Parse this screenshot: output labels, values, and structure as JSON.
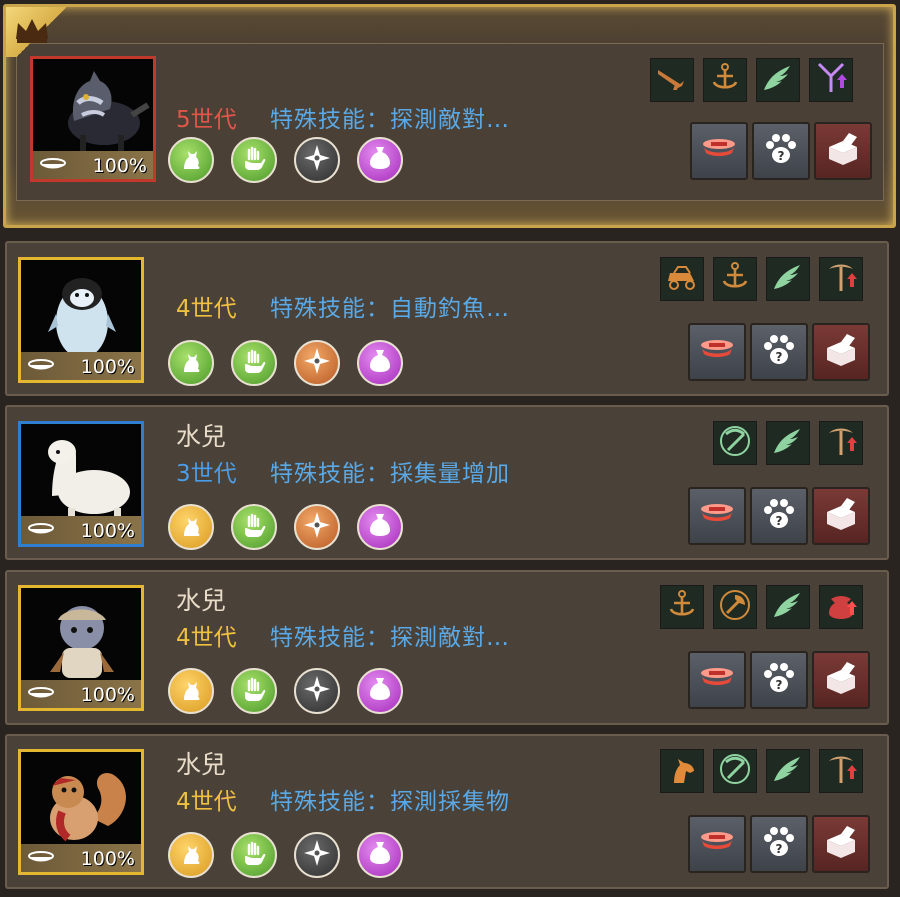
{
  "pets": [
    {
      "featured": true,
      "name": "",
      "generation": "5世代",
      "gen_color": "red",
      "skill": "特殊技能：探測敵對…",
      "percent": "100%",
      "frame": "red",
      "animal": "wolf",
      "traits": [
        {
          "icon": "cat-icon",
          "color": "green"
        },
        {
          "icon": "hand-icon",
          "color": "green"
        },
        {
          "icon": "compass-icon",
          "color": "gray"
        },
        {
          "icon": "pouch-icon",
          "color": "purple"
        }
      ],
      "badges": [
        "musket-icon",
        "anchor-icon",
        "wing-icon",
        "arrow-up-icon"
      ]
    },
    {
      "featured": false,
      "name": "",
      "generation": "4世代",
      "gen_color": "gold",
      "skill": "特殊技能：自動釣魚…",
      "percent": "100%",
      "frame": "gold",
      "animal": "penguin",
      "traits": [
        {
          "icon": "cat-icon",
          "color": "green"
        },
        {
          "icon": "hand-icon",
          "color": "green"
        },
        {
          "icon": "compass-icon",
          "color": "orange"
        },
        {
          "icon": "pouch-icon",
          "color": "purple"
        }
      ],
      "badges": [
        "carriage-icon",
        "anchor-icon",
        "wing-icon",
        "pickaxe-up-icon"
      ]
    },
    {
      "featured": false,
      "name": "水兒",
      "generation": "3世代",
      "gen_color": "blue",
      "skill": "特殊技能：採集量增加",
      "percent": "100%",
      "frame": "blue",
      "animal": "alpaca",
      "traits": [
        {
          "icon": "cat-icon",
          "color": "gold"
        },
        {
          "icon": "hand-icon",
          "color": "green"
        },
        {
          "icon": "compass-icon",
          "color": "orange"
        },
        {
          "icon": "pouch-icon",
          "color": "purple"
        }
      ],
      "badges": [
        "pickaxe-icon",
        "wing-icon",
        "pickaxe-up-icon"
      ]
    },
    {
      "featured": false,
      "name": "水兒",
      "generation": "4世代",
      "gen_color": "gold",
      "skill": "特殊技能：探測敵對…",
      "percent": "100%",
      "frame": "gold",
      "animal": "chibi",
      "traits": [
        {
          "icon": "cat-icon",
          "color": "gold"
        },
        {
          "icon": "hand-icon",
          "color": "green"
        },
        {
          "icon": "compass-icon",
          "color": "gray"
        },
        {
          "icon": "pouch-icon",
          "color": "purple"
        }
      ],
      "badges": [
        "anchor-icon",
        "axe-icon",
        "wing-icon",
        "bag-up-icon"
      ]
    },
    {
      "featured": false,
      "name": "水兒",
      "generation": "4世代",
      "gen_color": "gold",
      "skill": "特殊技能：探測採集物",
      "percent": "100%",
      "frame": "gold",
      "animal": "squirrel",
      "traits": [
        {
          "icon": "cat-icon",
          "color": "gold"
        },
        {
          "icon": "hand-icon",
          "color": "green"
        },
        {
          "icon": "compass-icon",
          "color": "gray"
        },
        {
          "icon": "pouch-icon",
          "color": "purple"
        }
      ],
      "badges": [
        "horse-icon",
        "pickaxe-icon",
        "wing-icon",
        "pickaxe-up-icon"
      ]
    }
  ],
  "colors": {
    "frame_red": "#c0392b",
    "frame_gold": "#e3b72e",
    "frame_blue": "#2f7fd0",
    "gen_red": "#e0574a",
    "gen_gold": "#f0c040",
    "gen_blue": "#4a9de8",
    "skill_blue": "#5aa9e6"
  },
  "actions": [
    "feed-button",
    "pet-info-button",
    "release-button"
  ]
}
